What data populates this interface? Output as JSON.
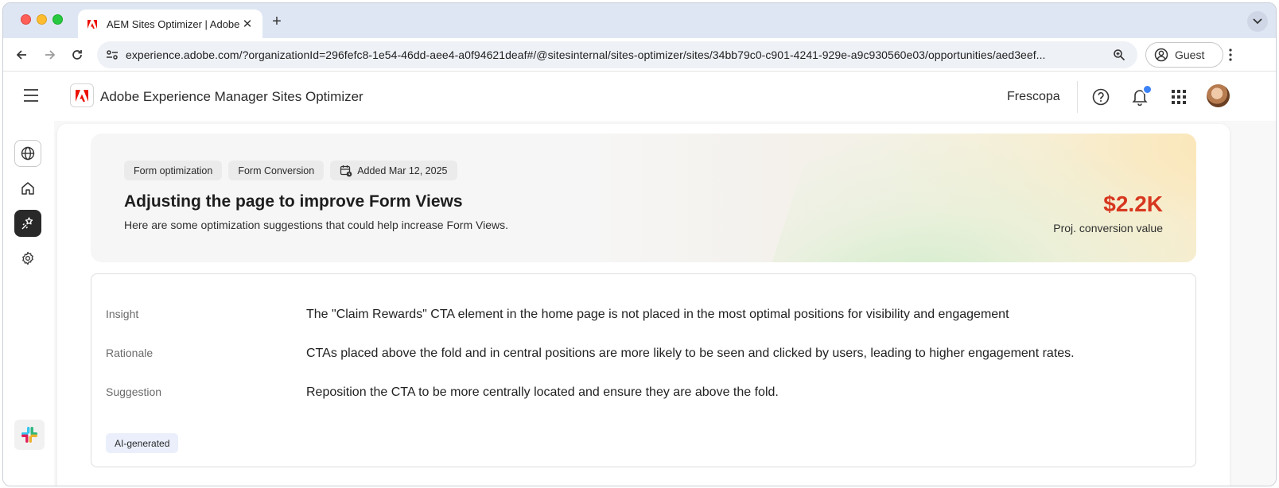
{
  "browser": {
    "tab": {
      "title": "AEM Sites Optimizer | Adobe E",
      "favicon": "adobe-logo-icon"
    },
    "new_tab_label": "+",
    "address": {
      "url": "experience.adobe.com/?organizationId=296fefc8-1e54-46dd-aee4-a0f94621deaf#/@sitesinternal/sites-optimizer/sites/34bb79c0-c901-4241-929e-a9c930560e03/opportunities/aed3eef..."
    },
    "profile_label": "Guest"
  },
  "app": {
    "title": "Adobe Experience Manager Sites Optimizer",
    "org": "Frescopa",
    "brand_color": "#eb1000",
    "notification_color": "#3b82f6"
  },
  "rail": {
    "items": [
      {
        "icon": "globe-icon"
      },
      {
        "icon": "home-icon"
      },
      {
        "icon": "optimize-icon",
        "active": true
      },
      {
        "icon": "gear-icon"
      }
    ],
    "bottom": {
      "icon": "slack-icon"
    }
  },
  "opportunity": {
    "tags": [
      "Form optimization",
      "Form Conversion",
      "Added Mar 12, 2025"
    ],
    "title": "Adjusting the page to improve Form Views",
    "subtitle": "Here are some optimization suggestions that could help increase Form Views.",
    "value": "$2.2K",
    "value_label": "Proj. conversion value",
    "value_color": "#d7371f"
  },
  "details": {
    "rows": [
      {
        "label": "Insight",
        "text": "The \"Claim Rewards\" CTA element in the home page is not placed in the most optimal positions for visibility and engagement"
      },
      {
        "label": "Rationale",
        "text": "CTAs placed above the fold and in central positions are more likely to be seen and clicked by users, leading to higher engagement rates."
      },
      {
        "label": "Suggestion",
        "text": "Reposition the CTA to be more centrally located and ensure they are above the fold."
      }
    ],
    "badge": "AI-generated"
  }
}
